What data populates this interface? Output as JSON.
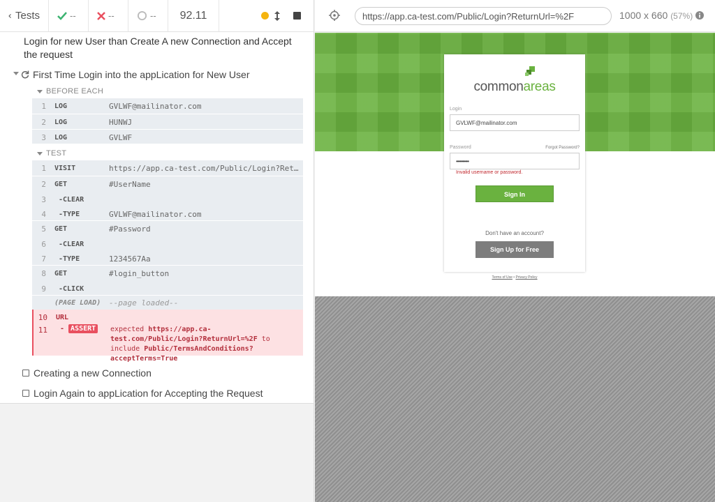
{
  "topbar": {
    "tests_label": "Tests",
    "passed": "--",
    "failed": "--",
    "pending": "--",
    "duration": "92.11"
  },
  "suite": {
    "title": "Login for new User than Create A new Connection and Accept the request",
    "test_title": "First Time Login into the appLication for New User",
    "before_each_label": "BEFORE EACH",
    "test_label": "TEST",
    "before_each_commands": [
      {
        "n": "1",
        "name": "LOG",
        "msg": "GVLWF@mailinator.com"
      },
      {
        "n": "2",
        "name": "LOG",
        "msg": "HUNWJ"
      },
      {
        "n": "3",
        "name": "LOG",
        "msg": "GVLWF"
      }
    ],
    "test_commands": [
      {
        "n": "1",
        "name": "VISIT",
        "msg": "https://app.ca-test.com/Public/Login?ReturnUrl=%2F"
      },
      {
        "n": "2",
        "name": "GET",
        "msg": "#UserName"
      },
      {
        "n": "3",
        "name": "-CLEAR",
        "msg": ""
      },
      {
        "n": "4",
        "name": "-TYPE",
        "msg": "GVLWF@mailinator.com"
      },
      {
        "n": "5",
        "name": "GET",
        "msg": "#Password"
      },
      {
        "n": "6",
        "name": "-CLEAR",
        "msg": ""
      },
      {
        "n": "7",
        "name": "-TYPE",
        "msg": "1234567Aa"
      },
      {
        "n": "8",
        "name": "GET",
        "msg": "#login_button"
      },
      {
        "n": "9",
        "name": "-CLICK",
        "msg": ""
      },
      {
        "n": "",
        "name": "(PAGE LOAD)",
        "msg": "--page loaded--"
      }
    ],
    "failed_commands": {
      "url_n": "10",
      "url_name": "URL",
      "assert_n": "11",
      "assert_badge": "ASSERT",
      "expected_word": "expected",
      "expected_url": "https://app.ca-test.com/Public/Login?ReturnUrl=%2F",
      "to_include": "to include",
      "included": "Public/TermsAndConditions?acceptTerms=True"
    },
    "other_tests": [
      "Creating a new Connection",
      "Login Again to appLication for Accepting the Request"
    ]
  },
  "aut": {
    "url": "https://app.ca-test.com/Public/Login?ReturnUrl=%2F",
    "viewport": "1000 x 660",
    "scale": "(57%)"
  },
  "login_page": {
    "logo_part1": "common",
    "logo_part2": "areas",
    "login_label": "Login",
    "login_value": "GVLWF@mailinator.com",
    "password_label": "Password",
    "forgot_label": "Forgot Password?",
    "password_value": "••••••••••",
    "error": "Invalid username or password.",
    "signin_label": "Sign In",
    "no_account": "Don't have an account?",
    "signup_label": "Sign Up for Free",
    "terms": "Terms of Use",
    "separator": "•",
    "privacy": "Privacy Policy"
  },
  "colors": {
    "brand_green": "#6ab23f",
    "fail_red": "#e94f5f",
    "pending_yellow": "#f5b40f"
  }
}
